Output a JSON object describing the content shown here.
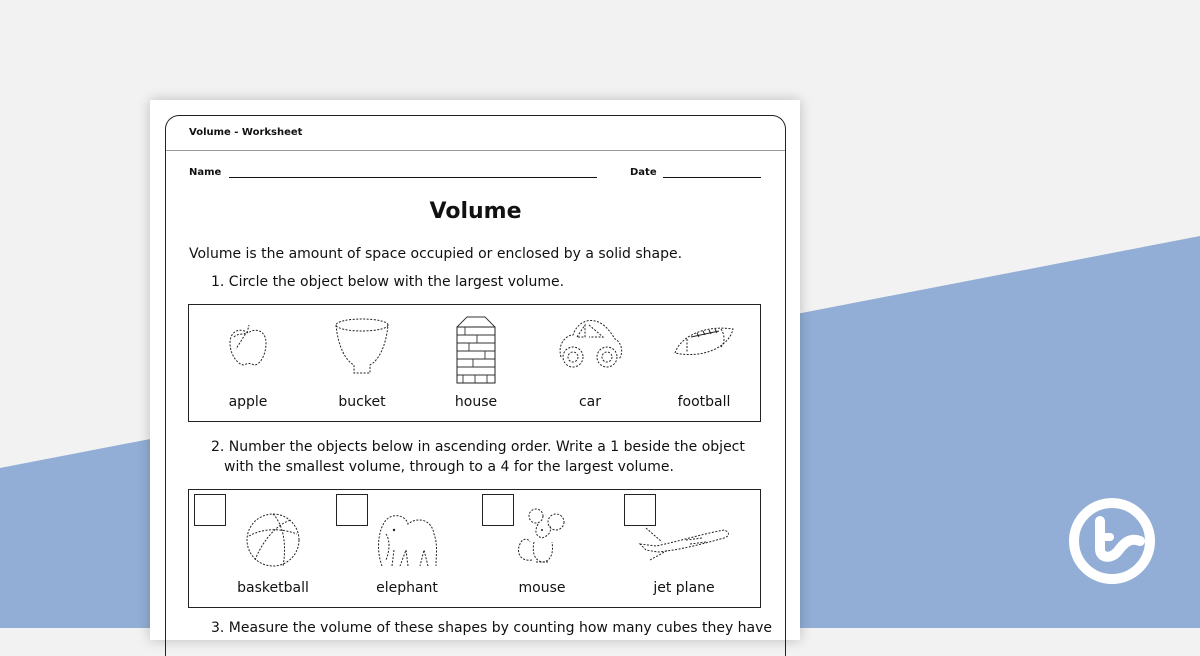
{
  "background": {
    "light": "#f2f2f2",
    "accent": "#92aed6"
  },
  "worksheet": {
    "header_title": "Volume - Worksheet",
    "name_label": "Name",
    "date_label": "Date",
    "title": "Volume",
    "intro": "Volume is the amount of space occupied or enclosed by a solid shape.",
    "q1": {
      "text": "1.  Circle the object below with the largest volume.",
      "items": [
        {
          "label": "apple",
          "icon": "apple-icon"
        },
        {
          "label": "bucket",
          "icon": "bucket-icon"
        },
        {
          "label": "house",
          "icon": "house-icon"
        },
        {
          "label": "car",
          "icon": "car-icon"
        },
        {
          "label": "football",
          "icon": "football-icon"
        }
      ]
    },
    "q2": {
      "text_line1": "2.  Number the objects below in ascending order. Write a 1 beside the object",
      "text_line2": "with the smallest volume, through to a 4 for the largest volume.",
      "items": [
        {
          "label": "basketball",
          "icon": "basketball-icon",
          "value": ""
        },
        {
          "label": "elephant",
          "icon": "elephant-icon",
          "value": ""
        },
        {
          "label": "mouse",
          "icon": "mouse-icon",
          "value": ""
        },
        {
          "label": "jet plane",
          "icon": "jet-plane-icon",
          "value": ""
        }
      ]
    },
    "q3": {
      "text": "3.  Measure the volume of these shapes by counting how many cubes they have"
    }
  },
  "brand": {
    "logo": "teach-starter-logo",
    "color": "#ffffff"
  }
}
